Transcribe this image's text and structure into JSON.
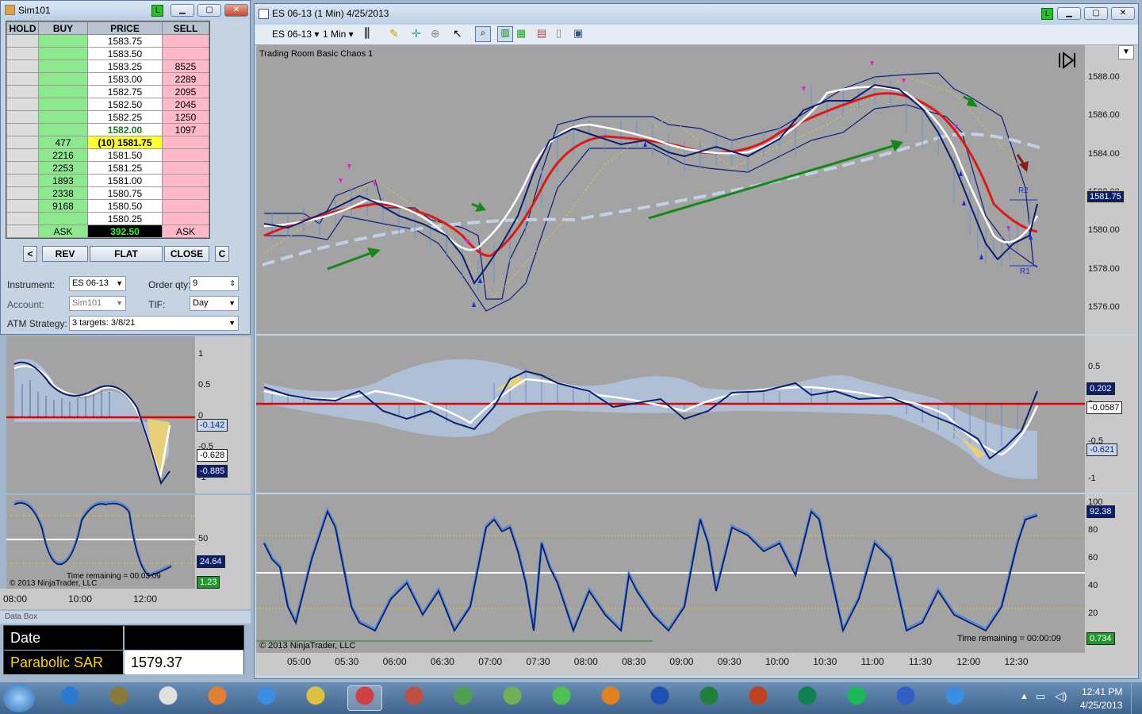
{
  "dom_window": {
    "title": "Sim101",
    "live_label": "L",
    "headers": [
      "HOLD",
      "BUY",
      "PRICE",
      "SELL"
    ],
    "rows": [
      {
        "hold": "",
        "buy": "",
        "price": "1583.75",
        "sell": ""
      },
      {
        "hold": "",
        "buy": "",
        "price": "1583.50",
        "sell": ""
      },
      {
        "hold": "",
        "buy": "",
        "price": "1583.25",
        "sell": "8525"
      },
      {
        "hold": "",
        "buy": "",
        "price": "1583.00",
        "sell": "2289"
      },
      {
        "hold": "",
        "buy": "",
        "price": "1582.75",
        "sell": "2095"
      },
      {
        "hold": "",
        "buy": "",
        "price": "1582.50",
        "sell": "2045"
      },
      {
        "hold": "",
        "buy": "",
        "price": "1582.25",
        "sell": "1250"
      },
      {
        "hold": "",
        "buy": "",
        "price": "1582.00",
        "sell": "1097"
      },
      {
        "hold": "",
        "buy": "477",
        "price": "(10) 1581.75",
        "sell": ""
      },
      {
        "hold": "",
        "buy": "2216",
        "price": "1581.50",
        "sell": ""
      },
      {
        "hold": "",
        "buy": "2253",
        "price": "1581.25",
        "sell": ""
      },
      {
        "hold": "",
        "buy": "1893",
        "price": "1581.00",
        "sell": ""
      },
      {
        "hold": "",
        "buy": "2338",
        "price": "1580.75",
        "sell": ""
      },
      {
        "hold": "",
        "buy": "9168",
        "price": "1580.50",
        "sell": ""
      },
      {
        "hold": "",
        "buy": "",
        "price": "1580.25",
        "sell": ""
      }
    ],
    "footer": {
      "buy": "ASK",
      "price": "392.50",
      "sell": "ASK"
    },
    "buttons": {
      "left": "<",
      "rev": "REV",
      "flat": "FLAT",
      "close": "CLOSE",
      "c": "C"
    },
    "instrument_label": "Instrument:",
    "instrument_value": "ES 06-13",
    "order_qty_label": "Order qty:",
    "order_qty_value": "9",
    "account_label": "Account:",
    "account_value": "Sim101",
    "tif_label": "TIF:",
    "tif_value": "Day",
    "atm_label": "ATM Strategy:",
    "atm_value": "3 targets: 3/8/21"
  },
  "mini_chart": {
    "yticks1": [
      "1",
      "0.5",
      "0",
      "-0.5",
      "-1"
    ],
    "tags1": [
      {
        "text": "-0.142",
        "kind": "light"
      },
      {
        "text": "-0.628",
        "kind": "white"
      },
      {
        "text": "-0.885",
        "kind": "navy"
      }
    ],
    "yticks2": [
      "50"
    ],
    "tags2": [
      {
        "text": "24.64",
        "kind": "navy"
      },
      {
        "text": "1.23",
        "kind": "green"
      }
    ],
    "time_remaining": "Time remaining = 00:03:09",
    "copyright": "© 2013 NinjaTrader, LLC",
    "xticks": [
      "08:00",
      "10:00",
      "12:00"
    ]
  },
  "data_box": {
    "title": "Data Box",
    "date_label": "Date",
    "date_value": "",
    "sar_label": "Parabolic SAR",
    "sar_value": "1579.37"
  },
  "chart_window": {
    "title": "ES 06-13 (1 Min)  4/25/2013",
    "live_label": "L",
    "toolbar": {
      "instrument": "ES 06-13",
      "interval": "1 Min"
    },
    "template_name": "Trading Room Basic Chaos 1",
    "price_ticks": [
      "1588.00",
      "1586.00",
      "1584.00",
      "1582.00",
      "1580.00",
      "1578.00",
      "1576.00"
    ],
    "price_tag": "1581.75",
    "r2_label": "R2",
    "r1_label": "R1",
    "osc_ticks": [
      "0.5",
      "0",
      "-0.5",
      "-1"
    ],
    "osc_tags": [
      {
        "text": "0.202",
        "kind": "navy"
      },
      {
        "text": "-0.0587",
        "kind": "white"
      },
      {
        "text": "-0.621",
        "kind": "light"
      }
    ],
    "stoch_ticks": [
      "100",
      "80",
      "60",
      "40",
      "20"
    ],
    "stoch_tags": [
      {
        "text": "92.38",
        "kind": "navy"
      },
      {
        "text": "0.734",
        "kind": "green"
      }
    ],
    "time_remaining": "Time remaining = 00:00:09",
    "copyright": "© 2013 NinjaTrader, LLC",
    "xticks": [
      "05:00",
      "05:30",
      "06:00",
      "06:30",
      "07:00",
      "07:30",
      "08:00",
      "08:30",
      "09:00",
      "09:30",
      "10:00",
      "10:30",
      "11:00",
      "11:30",
      "12:00",
      "12:30"
    ]
  },
  "taskbar": {
    "apps": [
      "start-orb",
      "internet-explorer",
      "game-app",
      "document-viewer",
      "media-player",
      "messenger",
      "file-explorer",
      "ninjatrader",
      "navigation-app",
      "network-app",
      "notes-app",
      "dice-app",
      "outlook",
      "word",
      "excel",
      "powerpoint",
      "publisher",
      "spotify",
      "flower-app",
      "internet-explorer-2"
    ],
    "time": "12:41 PM",
    "date": "4/25/2013"
  }
}
